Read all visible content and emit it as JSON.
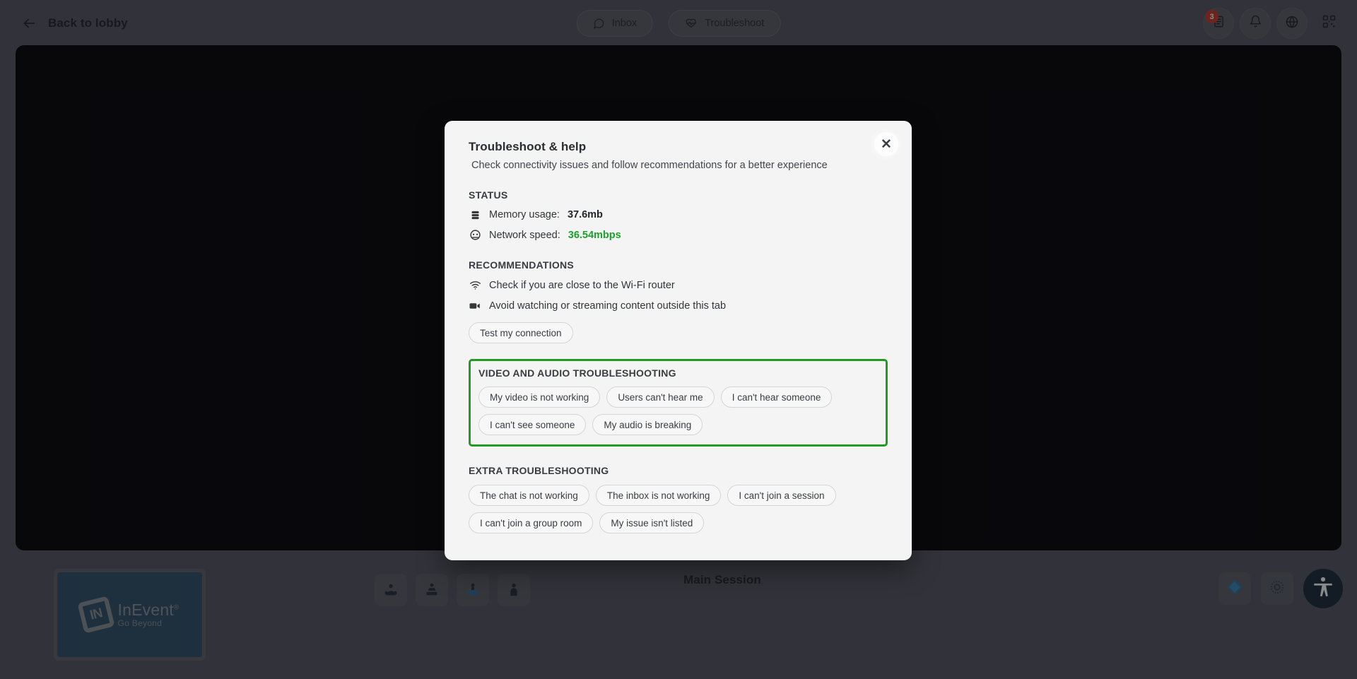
{
  "topbar": {
    "back_label": "Back to lobby",
    "back_icon": "arrow-left-icon",
    "pills": [
      {
        "label": "Inbox",
        "icon": "chat-bubble-icon"
      },
      {
        "label": "Troubleshoot",
        "icon": "heart-pulse-icon"
      }
    ],
    "icons": [
      {
        "name": "agenda-icon",
        "badge": "3"
      },
      {
        "name": "bell-icon",
        "badge": ""
      },
      {
        "name": "globe-icon",
        "badge": ""
      },
      {
        "name": "qr-code-icon",
        "badge": ""
      }
    ]
  },
  "stage": {
    "session_title": "Main Session",
    "thumbnail": {
      "logo_mark": "IN",
      "logo_name": "InEvent",
      "logo_superscript": "®",
      "logo_tagline": "Go Beyond"
    },
    "tools": [
      {
        "name": "layout-speaker-icon"
      },
      {
        "name": "layout-presentation-icon"
      },
      {
        "name": "layout-active-icon"
      },
      {
        "name": "layout-person-icon"
      }
    ],
    "bottom_right": [
      {
        "name": "diamond-gem-icon"
      },
      {
        "name": "settings-gear-icon"
      },
      {
        "name": "accessibility-icon"
      }
    ]
  },
  "modal": {
    "title": "Troubleshoot & help",
    "subtitle": "Check connectivity issues and follow recommendations for a better experience",
    "close_label": "✕",
    "status": {
      "heading": "STATUS",
      "rows": [
        {
          "icon": "database-icon",
          "label": "Memory usage:",
          "value": "37.6mb",
          "value_style": "bold"
        },
        {
          "icon": "speedometer-icon",
          "label": "Network speed:",
          "value": "36.54mbps",
          "value_style": "green"
        }
      ]
    },
    "recommendations": {
      "heading": "RECOMMENDATIONS",
      "items": [
        {
          "icon": "wifi-icon",
          "text": "Check if you are close to the Wi-Fi router"
        },
        {
          "icon": "video-camera-icon",
          "text": "Avoid watching or streaming content outside this tab"
        }
      ],
      "action_label": "Test my connection"
    },
    "video_audio": {
      "heading": "VIDEO AND AUDIO TROUBLESHOOTING",
      "highlight_color": "#1f9c21",
      "chips": [
        "My video is not working",
        "Users can't hear me",
        "I can't hear someone",
        "I can't see someone",
        "My audio is breaking"
      ]
    },
    "extra": {
      "heading": "EXTRA TROUBLESHOOTING",
      "chips": [
        "The chat is not working",
        "The inbox is not working",
        "I can't join a session",
        "I can't join a group room",
        "My issue isn't listed"
      ]
    }
  }
}
